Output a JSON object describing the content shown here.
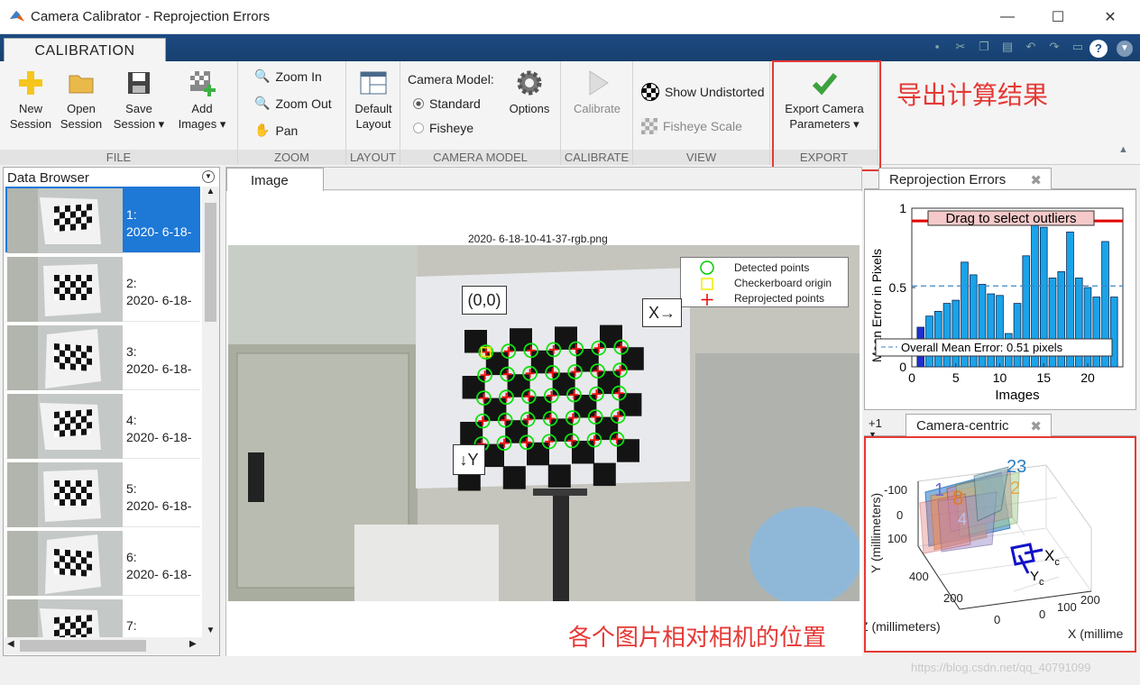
{
  "window": {
    "title": "Camera Calibrator - Reprojection Errors",
    "minimize": "—",
    "maximize": "☐",
    "close": "✕"
  },
  "tab": "CALIBRATION",
  "ribbon": {
    "file": {
      "label": "FILE",
      "new_session": [
        "New",
        "Session"
      ],
      "open_session": [
        "Open",
        "Session"
      ],
      "save_session": [
        "Save",
        "Session ▾"
      ],
      "add_images": [
        "Add",
        "Images ▾"
      ]
    },
    "zoom": {
      "label": "ZOOM",
      "zoom_in": "Zoom In",
      "zoom_out": "Zoom Out",
      "pan": "Pan"
    },
    "layout": {
      "label": "LAYOUT",
      "default_layout": [
        "Default",
        "Layout"
      ]
    },
    "camera_model": {
      "label": "CAMERA MODEL",
      "title": "Camera Model:",
      "standard": "Standard",
      "fisheye": "Fisheye",
      "options": "Options"
    },
    "calibrate": {
      "label": "CALIBRATE",
      "calibrate": "Calibrate"
    },
    "view": {
      "label": "VIEW",
      "show_undistorted": "Show Undistorted",
      "fisheye_scale": "Fisheye Scale"
    },
    "export": {
      "label": "EXPORT",
      "export_camera": [
        "Export Camera",
        "Parameters ▾"
      ]
    }
  },
  "annotations": {
    "export_note": "导出计算结果",
    "position_note": "各个图片相对相机的位置"
  },
  "data_browser": {
    "title": "Data Browser",
    "items": [
      {
        "num": "1:",
        "name": "2020- 6-18-"
      },
      {
        "num": "2:",
        "name": "2020- 6-18-"
      },
      {
        "num": "3:",
        "name": "2020- 6-18-"
      },
      {
        "num": "4:",
        "name": "2020- 6-18-"
      },
      {
        "num": "5:",
        "name": "2020- 6-18-"
      },
      {
        "num": "6:",
        "name": "2020- 6-18-"
      },
      {
        "num": "7:",
        "name": ""
      }
    ]
  },
  "image_panel": {
    "tab": "Image",
    "filename": "2020- 6-18-10-41-37-rgb.png",
    "legend": [
      "Detected points",
      "Checkerboard origin",
      "Reprojected points"
    ],
    "labels": {
      "origin": "(0,0)",
      "x_axis": "X→",
      "y_axis": "↓Y"
    }
  },
  "reprojection_panel": {
    "tab": "Reprojection Errors",
    "drag_label": "Drag to select outliers",
    "mean_label": "Overall Mean Error: 0.51 pixels"
  },
  "camera_panel": {
    "tab": "Camera-centric",
    "tab_extra": "+1",
    "ylabel": "Y (millimeters)",
    "zlabel": "Z (millimeters)",
    "xlabel": "X (millime",
    "ticks_y": [
      "-100",
      "0",
      "100"
    ],
    "ticks_z": [
      "400",
      "200",
      "0"
    ],
    "ticks_x": [
      "0",
      "100",
      "200"
    ],
    "pattern_ids": [
      "23",
      "2",
      "1",
      "8",
      "4"
    ],
    "axis_x": "X",
    "axis_y": "Y",
    "axis_sub": "c"
  },
  "watermark": "https://blog.csdn.net/qq_40791099",
  "chart_data": {
    "type": "bar",
    "title": "",
    "xlabel": "Images",
    "ylabel": "Mean Error in Pixels",
    "ylim": [
      0,
      1
    ],
    "xlim": [
      0,
      24
    ],
    "xticks": [
      0,
      5,
      10,
      15,
      20
    ],
    "yticks": [
      0,
      0.5,
      1
    ],
    "categories": [
      1,
      2,
      3,
      4,
      5,
      6,
      7,
      8,
      9,
      10,
      11,
      12,
      13,
      14,
      15,
      16,
      17,
      18,
      19,
      20,
      21,
      22,
      23
    ],
    "values": [
      0.25,
      0.32,
      0.35,
      0.4,
      0.42,
      0.66,
      0.58,
      0.52,
      0.46,
      0.45,
      0.21,
      0.4,
      0.7,
      0.91,
      0.88,
      0.56,
      0.6,
      0.85,
      0.56,
      0.5,
      0.44,
      0.79,
      0.44
    ],
    "selected": [
      1
    ],
    "mean": 0.51,
    "threshold": 0.92,
    "colors": {
      "bar": "#1aa3e8",
      "bar_selected": "#1f2fd0",
      "mean_line": "#3a86c8",
      "threshold_line": "#e00000"
    }
  }
}
